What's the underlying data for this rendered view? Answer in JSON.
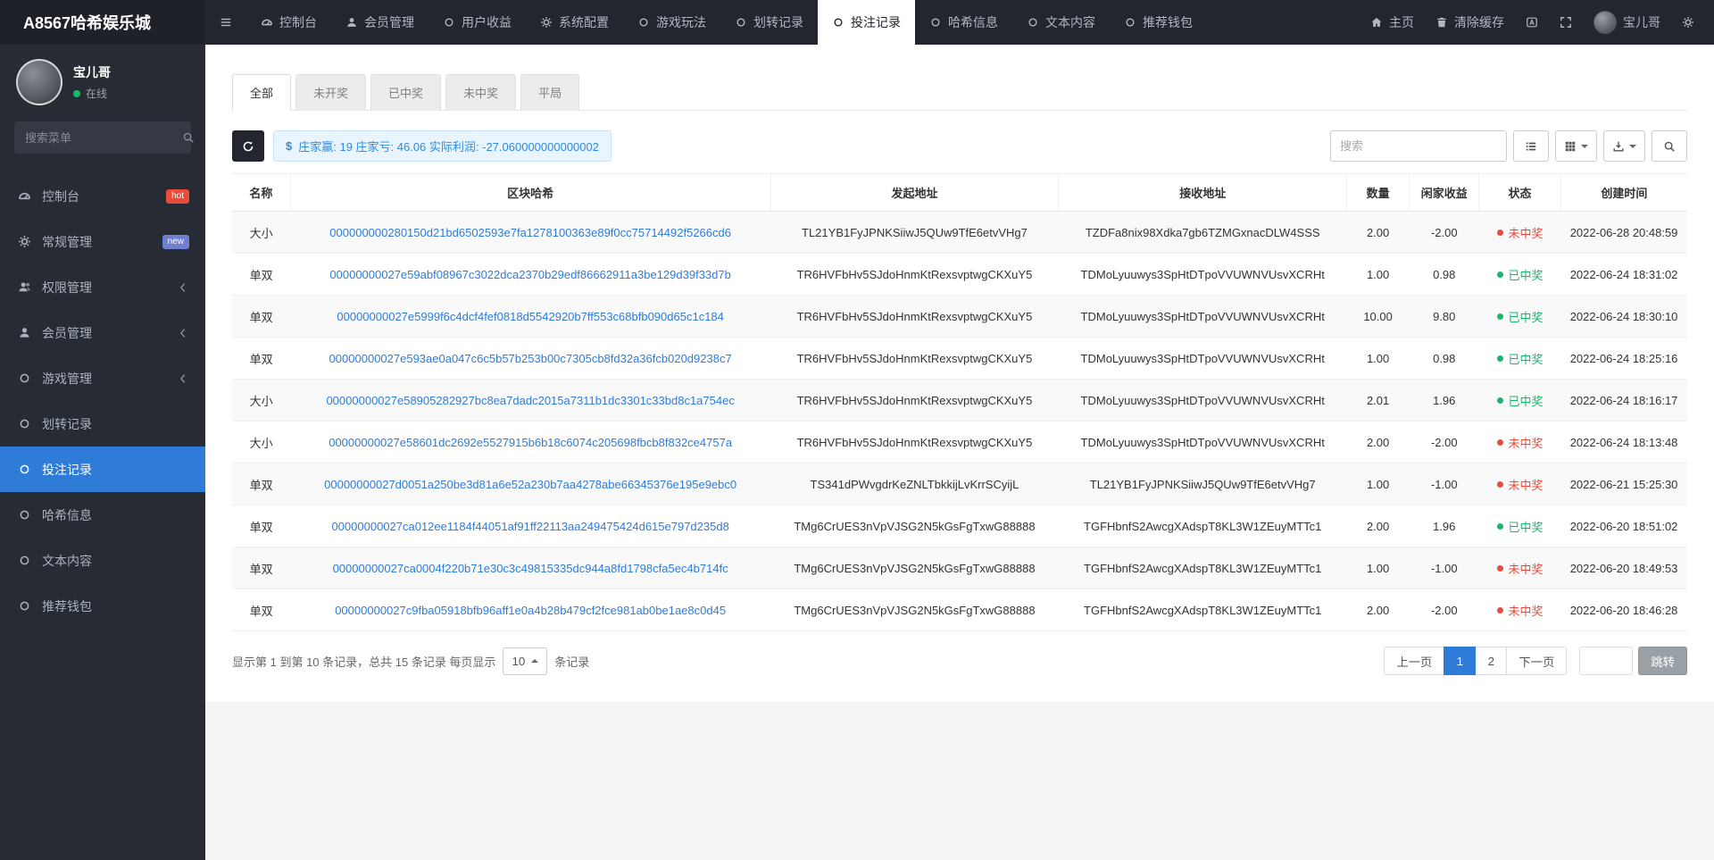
{
  "colors": {
    "topbar_bg": "#23262e",
    "sidebar_bg": "#272b34",
    "accent_blue": "#2f7cd8",
    "win_green": "#18b76d",
    "lose_red": "#e74c3c",
    "badge_hot": "#e74c3c",
    "badge_new": "#6e7fd0",
    "summary_bg": "#e9f5fe"
  },
  "topbar": {
    "brand": "A8567哈希娱乐城",
    "menu": [
      {
        "label": "控制台",
        "icon": "dashboard-icon"
      },
      {
        "label": "会员管理",
        "icon": "user-icon"
      },
      {
        "label": "用户收益",
        "icon": "circle-icon"
      },
      {
        "label": "系统配置",
        "icon": "gear-icon"
      },
      {
        "label": "游戏玩法",
        "icon": "circle-icon"
      },
      {
        "label": "划转记录",
        "icon": "circle-icon"
      },
      {
        "label": "投注记录",
        "icon": "circle-icon",
        "active": true
      },
      {
        "label": "哈希信息",
        "icon": "circle-icon"
      },
      {
        "label": "文本内容",
        "icon": "circle-icon"
      },
      {
        "label": "推荐钱包",
        "icon": "circle-icon"
      }
    ],
    "home": "主页",
    "clear_cache": "清除缓存",
    "username": "宝儿哥"
  },
  "sidebar": {
    "user_name": "宝儿哥",
    "user_status": "在线",
    "search_placeholder": "搜索菜单",
    "items": [
      {
        "label": "控制台",
        "badge": "hot"
      },
      {
        "label": "常规管理",
        "badge": "new"
      },
      {
        "label": "权限管理",
        "collapsible": true
      },
      {
        "label": "会员管理",
        "collapsible": true
      },
      {
        "label": "游戏管理",
        "collapsible": true
      },
      {
        "label": "划转记录"
      },
      {
        "label": "投注记录",
        "active": true
      },
      {
        "label": "哈希信息"
      },
      {
        "label": "文本内容"
      },
      {
        "label": "推荐钱包"
      }
    ]
  },
  "tabs": [
    {
      "label": "全部",
      "active": true
    },
    {
      "label": "未开奖"
    },
    {
      "label": "已中奖"
    },
    {
      "label": "未中奖"
    },
    {
      "label": "平局"
    }
  ],
  "toolbar": {
    "dollar": "$",
    "summary": "庄家赢: 19 庄家亏: 46.06 实际利润: -27.060000000000002",
    "search_placeholder": "搜索"
  },
  "table": {
    "columns": [
      "名称",
      "区块哈希",
      "发起地址",
      "接收地址",
      "数量",
      "闲家收益",
      "状态",
      "创建时间"
    ],
    "rows": [
      {
        "name": "大小",
        "hash": "000000000280150d21bd6502593e7fa1278100363e89f0cc75714492f5266cd6",
        "from": "TL21YB1FyJPNKSiiwJ5QUw9TfE6etvVHg7",
        "to": "TZDFa8nix98Xdka7gb6TZMGxnacDLW4SSS",
        "amount": "2.00",
        "profit": "-2.00",
        "status": "未中奖",
        "result": "lose",
        "time": "2022-06-28 20:48:59"
      },
      {
        "name": "单双",
        "hash": "00000000027e59abf08967c3022dca2370b29edf86662911a3be129d39f33d7b",
        "from": "TR6HVFbHv5SJdoHnmKtRexsvptwgCKXuY5",
        "to": "TDMoLyuuwys3SpHtDTpoVVUWNVUsvXCRHt",
        "amount": "1.00",
        "profit": "0.98",
        "status": "已中奖",
        "result": "win",
        "time": "2022-06-24 18:31:02"
      },
      {
        "name": "单双",
        "hash": "00000000027e5999f6c4dcf4fef0818d5542920b7ff553c68bfb090d65c1c184",
        "from": "TR6HVFbHv5SJdoHnmKtRexsvptwgCKXuY5",
        "to": "TDMoLyuuwys3SpHtDTpoVVUWNVUsvXCRHt",
        "amount": "10.00",
        "profit": "9.80",
        "status": "已中奖",
        "result": "win",
        "time": "2022-06-24 18:30:10"
      },
      {
        "name": "单双",
        "hash": "00000000027e593ae0a047c6c5b57b253b00c7305cb8fd32a36fcb020d9238c7",
        "from": "TR6HVFbHv5SJdoHnmKtRexsvptwgCKXuY5",
        "to": "TDMoLyuuwys3SpHtDTpoVVUWNVUsvXCRHt",
        "amount": "1.00",
        "profit": "0.98",
        "status": "已中奖",
        "result": "win",
        "time": "2022-06-24 18:25:16"
      },
      {
        "name": "大小",
        "hash": "00000000027e58905282927bc8ea7dadc2015a7311b1dc3301c33bd8c1a754ec",
        "from": "TR6HVFbHv5SJdoHnmKtRexsvptwgCKXuY5",
        "to": "TDMoLyuuwys3SpHtDTpoVVUWNVUsvXCRHt",
        "amount": "2.01",
        "profit": "1.96",
        "status": "已中奖",
        "result": "win",
        "time": "2022-06-24 18:16:17"
      },
      {
        "name": "大小",
        "hash": "00000000027e58601dc2692e5527915b6b18c6074c205698fbcb8f832ce4757a",
        "from": "TR6HVFbHv5SJdoHnmKtRexsvptwgCKXuY5",
        "to": "TDMoLyuuwys3SpHtDTpoVVUWNVUsvXCRHt",
        "amount": "2.00",
        "profit": "-2.00",
        "status": "未中奖",
        "result": "lose",
        "time": "2022-06-24 18:13:48"
      },
      {
        "name": "单双",
        "hash": "00000000027d0051a250be3d81a6e52a230b7aa4278abe66345376e195e9ebc0",
        "from": "TS341dPWvgdrKeZNLTbkkijLvKrrSCyijL",
        "to": "TL21YB1FyJPNKSiiwJ5QUw9TfE6etvVHg7",
        "amount": "1.00",
        "profit": "-1.00",
        "status": "未中奖",
        "result": "lose",
        "time": "2022-06-21 15:25:30"
      },
      {
        "name": "单双",
        "hash": "00000000027ca012ee1184f44051af91ff22113aa249475424d615e797d235d8",
        "from": "TMg6CrUES3nVpVJSG2N5kGsFgTxwG88888",
        "to": "TGFHbnfS2AwcgXAdspT8KL3W1ZEuyMTTc1",
        "amount": "2.00",
        "profit": "1.96",
        "status": "已中奖",
        "result": "win",
        "time": "2022-06-20 18:51:02"
      },
      {
        "name": "单双",
        "hash": "00000000027ca0004f220b71e30c3c49815335dc944a8fd1798cfa5ec4b714fc",
        "from": "TMg6CrUES3nVpVJSG2N5kGsFgTxwG88888",
        "to": "TGFHbnfS2AwcgXAdspT8KL3W1ZEuyMTTc1",
        "amount": "1.00",
        "profit": "-1.00",
        "status": "未中奖",
        "result": "lose",
        "time": "2022-06-20 18:49:53"
      },
      {
        "name": "单双",
        "hash": "00000000027c9fba05918bfb96aff1e0a4b28b479cf2fce981ab0be1ae8c0d45",
        "from": "TMg6CrUES3nVpVJSG2N5kGsFgTxwG88888",
        "to": "TGFHbnfS2AwcgXAdspT8KL3W1ZEuyMTTc1",
        "amount": "2.00",
        "profit": "-2.00",
        "status": "未中奖",
        "result": "lose",
        "time": "2022-06-20 18:46:28"
      }
    ]
  },
  "pagination": {
    "info_before": "显示第 1 到第 10 条记录，总共 15 条记录 每页显示",
    "page_size": "10",
    "info_after": "条记录",
    "prev": "上一页",
    "next": "下一页",
    "pages": [
      "1",
      "2"
    ],
    "active_page": "1",
    "jump_label": "跳转"
  }
}
